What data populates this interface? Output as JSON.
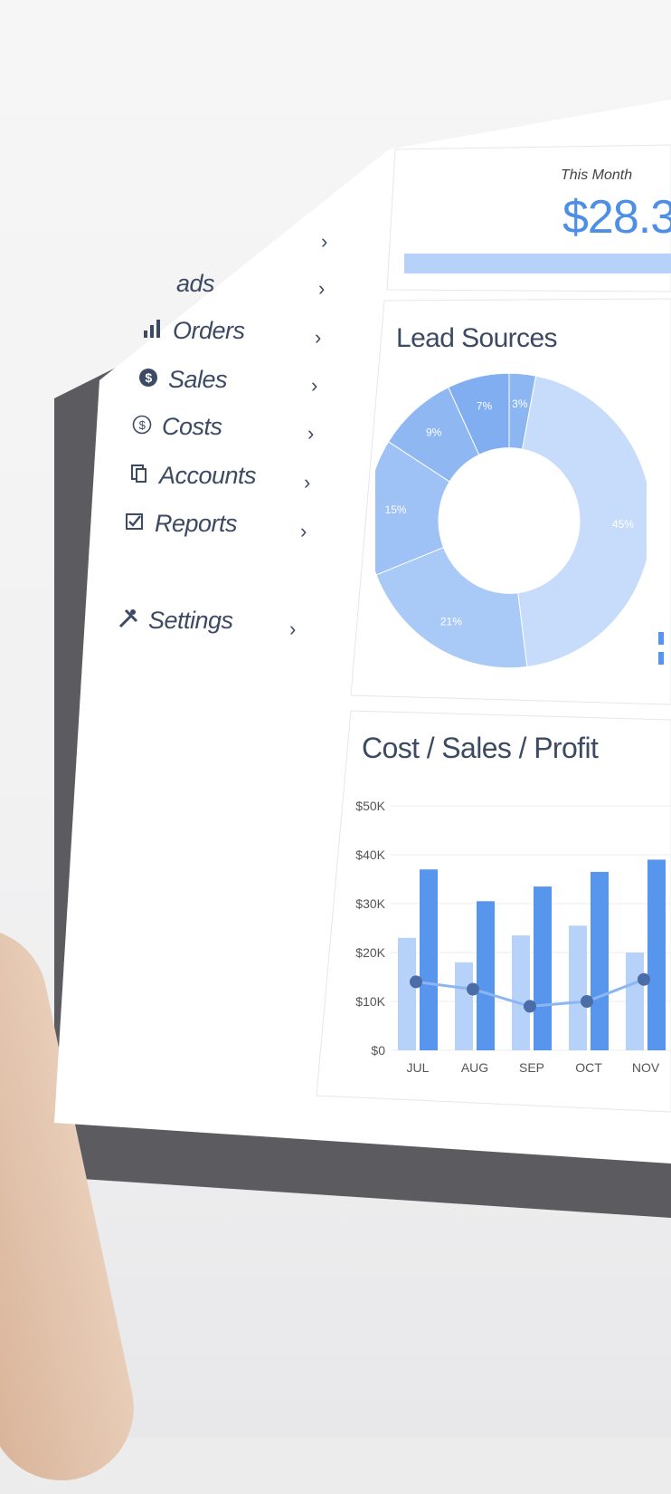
{
  "kpi": {
    "label": "This Month",
    "value": "$28.3"
  },
  "sidebar": {
    "items": [
      {
        "label": "",
        "icon": "none"
      },
      {
        "label": "ads",
        "icon": "none"
      },
      {
        "label": "Orders",
        "icon": "bar-chart-icon"
      },
      {
        "label": "Sales",
        "icon": "dollar-circle-icon"
      },
      {
        "label": "Costs",
        "icon": "dollar-outline-icon"
      },
      {
        "label": "Accounts",
        "icon": "copy-icon"
      },
      {
        "label": "Reports",
        "icon": "checkbox-icon"
      },
      {
        "label": "Settings",
        "icon": "tools-icon"
      }
    ],
    "chevron": "›"
  },
  "lead_sources": {
    "title": "Lead Sources"
  },
  "cost_chart": {
    "title": "Cost / Sales / Profit"
  },
  "colors": {
    "light_blue": "#b6d2f8",
    "mid_blue": "#8cb6f2",
    "blue": "#5896ee",
    "dark_dot": "#4a6da8",
    "text": "#3c4a63"
  },
  "chart_data": [
    {
      "type": "pie",
      "title": "Lead Sources",
      "labels": [
        "3%",
        "45%",
        "21%",
        "15%",
        "9%",
        "7%"
      ],
      "values": [
        3,
        45,
        21,
        15,
        9,
        7
      ]
    },
    {
      "type": "bar",
      "title": "Cost / Sales / Profit",
      "categories": [
        "JUL",
        "AUG",
        "SEP",
        "OCT",
        "NOV"
      ],
      "series": [
        {
          "values": [
            23000,
            18000,
            23500,
            25500,
            20000
          ]
        },
        {
          "values": [
            37000,
            30500,
            33500,
            36500,
            39000
          ]
        },
        {
          "values": [
            14000,
            12500,
            9000,
            10000,
            14500
          ]
        }
      ],
      "y_ticks": [
        "$0",
        "$10K",
        "$20K",
        "$30K",
        "$40K",
        "$50K"
      ],
      "ylim": [
        0,
        50000
      ]
    }
  ]
}
